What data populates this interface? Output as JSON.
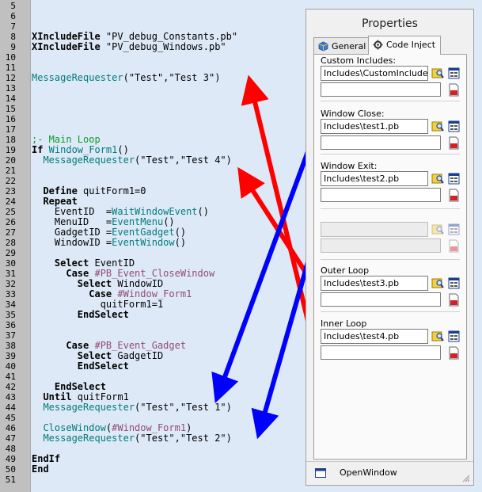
{
  "editor": {
    "lines": [
      {
        "n": "5",
        "segs": []
      },
      {
        "n": "6",
        "segs": []
      },
      {
        "n": "7",
        "segs": []
      },
      {
        "n": "8",
        "segs": [
          {
            "t": "XIncludeFile",
            "c": "kw"
          },
          {
            "t": " \"PV_debug_Constants.pb\"",
            "c": "tx"
          }
        ]
      },
      {
        "n": "9",
        "segs": [
          {
            "t": "XIncludeFile",
            "c": "kw"
          },
          {
            "t": " \"PV_debug_Windows.pb\"",
            "c": "tx"
          }
        ]
      },
      {
        "n": "10",
        "segs": []
      },
      {
        "n": "11",
        "segs": []
      },
      {
        "n": "12",
        "segs": [
          {
            "t": "MessageRequester",
            "c": "fn"
          },
          {
            "t": "(\"Test\",\"Test 3\")",
            "c": "tx"
          }
        ]
      },
      {
        "n": "13",
        "segs": []
      },
      {
        "n": "14",
        "segs": []
      },
      {
        "n": "15",
        "segs": []
      },
      {
        "n": "16",
        "segs": []
      },
      {
        "n": "17",
        "segs": []
      },
      {
        "n": "18",
        "segs": [
          {
            "t": ";- Main Loop",
            "c": "cm"
          }
        ]
      },
      {
        "n": "19",
        "segs": [
          {
            "t": "If",
            "c": "kw"
          },
          {
            "t": " Window_Form1",
            "c": "fn"
          },
          {
            "t": "()",
            "c": "tx"
          }
        ]
      },
      {
        "n": "20",
        "segs": [
          {
            "t": "  MessageRequester",
            "c": "fn"
          },
          {
            "t": "(\"Test\",\"Test 4\")",
            "c": "tx"
          }
        ]
      },
      {
        "n": "21",
        "segs": []
      },
      {
        "n": "22",
        "segs": []
      },
      {
        "n": "23",
        "segs": [
          {
            "t": "  Define",
            "c": "kw"
          },
          {
            "t": " quitForm1=0",
            "c": "tx"
          }
        ]
      },
      {
        "n": "24",
        "segs": [
          {
            "t": "  Repeat",
            "c": "kw"
          }
        ]
      },
      {
        "n": "25",
        "segs": [
          {
            "t": "    EventID  =",
            "c": "tx"
          },
          {
            "t": "WaitWindowEvent",
            "c": "fn"
          },
          {
            "t": "()",
            "c": "tx"
          }
        ]
      },
      {
        "n": "26",
        "segs": [
          {
            "t": "    MenuID   =",
            "c": "tx"
          },
          {
            "t": "EventMenu",
            "c": "fn"
          },
          {
            "t": "()",
            "c": "tx"
          }
        ]
      },
      {
        "n": "27",
        "segs": [
          {
            "t": "    GadgetID =",
            "c": "tx"
          },
          {
            "t": "EventGadget",
            "c": "fn"
          },
          {
            "t": "()",
            "c": "tx"
          }
        ]
      },
      {
        "n": "28",
        "segs": [
          {
            "t": "    WindowID =",
            "c": "tx"
          },
          {
            "t": "EventWindow",
            "c": "fn"
          },
          {
            "t": "()",
            "c": "tx"
          }
        ]
      },
      {
        "n": "29",
        "segs": []
      },
      {
        "n": "30",
        "segs": [
          {
            "t": "    Select",
            "c": "kw"
          },
          {
            "t": " EventID",
            "c": "tx"
          }
        ]
      },
      {
        "n": "31",
        "segs": [
          {
            "t": "      Case",
            "c": "kw"
          },
          {
            "t": " #PB_Event_CloseWindow",
            "c": "cst"
          }
        ]
      },
      {
        "n": "32",
        "segs": [
          {
            "t": "        Select",
            "c": "kw"
          },
          {
            "t": " WindowID",
            "c": "tx"
          }
        ]
      },
      {
        "n": "33",
        "segs": [
          {
            "t": "          Case",
            "c": "kw"
          },
          {
            "t": " #Window_Form1",
            "c": "cst"
          }
        ]
      },
      {
        "n": "34",
        "segs": [
          {
            "t": "            quitForm1=1",
            "c": "tx"
          }
        ]
      },
      {
        "n": "35",
        "segs": [
          {
            "t": "        EndSelect",
            "c": "kw"
          }
        ]
      },
      {
        "n": "36",
        "segs": []
      },
      {
        "n": "37",
        "segs": []
      },
      {
        "n": "38",
        "segs": [
          {
            "t": "      Case",
            "c": "kw"
          },
          {
            "t": " #PB_Event_Gadget",
            "c": "cst"
          }
        ]
      },
      {
        "n": "39",
        "segs": [
          {
            "t": "        Select",
            "c": "kw"
          },
          {
            "t": " GadgetID",
            "c": "tx"
          }
        ]
      },
      {
        "n": "40",
        "segs": [
          {
            "t": "        EndSelect",
            "c": "kw"
          }
        ]
      },
      {
        "n": "41",
        "segs": []
      },
      {
        "n": "42",
        "segs": [
          {
            "t": "    EndSelect",
            "c": "kw"
          }
        ]
      },
      {
        "n": "43",
        "segs": [
          {
            "t": "  Until",
            "c": "kw"
          },
          {
            "t": " quitForm1",
            "c": "tx"
          }
        ]
      },
      {
        "n": "44",
        "segs": [
          {
            "t": "  MessageRequester",
            "c": "fn"
          },
          {
            "t": "(\"Test\",\"Test 1\")",
            "c": "tx"
          }
        ]
      },
      {
        "n": "45",
        "segs": []
      },
      {
        "n": "46",
        "segs": [
          {
            "t": "  CloseWindow",
            "c": "fn"
          },
          {
            "t": "(",
            "c": "tx"
          },
          {
            "t": "#Window_Form1",
            "c": "cst"
          },
          {
            "t": ")",
            "c": "tx"
          }
        ]
      },
      {
        "n": "47",
        "segs": [
          {
            "t": "  MessageRequester",
            "c": "fn"
          },
          {
            "t": "(\"Test\",\"Test 2\")",
            "c": "tx"
          }
        ]
      },
      {
        "n": "48",
        "segs": []
      },
      {
        "n": "49",
        "segs": [
          {
            "t": "EndIf",
            "c": "kw"
          }
        ]
      },
      {
        "n": "50",
        "segs": [
          {
            "t": "End",
            "c": "kw"
          }
        ]
      },
      {
        "n": "51",
        "segs": []
      }
    ]
  },
  "properties": {
    "title": "Properties",
    "tabs": [
      {
        "label": "General",
        "icon": "cube-icon"
      },
      {
        "label": "Code Inject",
        "icon": "gear-icon"
      }
    ],
    "fields": [
      {
        "label": "Custom Includes:",
        "value": "Includes\\CustomIncludes",
        "disabled": false
      },
      {
        "label": "Window Close:",
        "value": "Includes\\test1.pb",
        "disabled": false
      },
      {
        "label": "Window Exit:",
        "value": "Includes\\test2.pb",
        "disabled": false
      },
      {
        "label": "",
        "value": "",
        "disabled": true
      },
      {
        "label": "Outer Loop",
        "value": "Includes\\test3.pb",
        "disabled": false
      },
      {
        "label": "Inner Loop",
        "value": "Includes\\test4.pb",
        "disabled": false
      }
    ],
    "status": "OpenWindow"
  },
  "colors": {
    "editor_bg": "#dde9f7",
    "gutter_bg": "#c0c0c0",
    "keyword": "#000000",
    "function": "#007b7b",
    "constant": "#924b72",
    "comment": "#0b9a2f",
    "arrow_red": "#ff0000",
    "arrow_blue": "#0000ff"
  }
}
